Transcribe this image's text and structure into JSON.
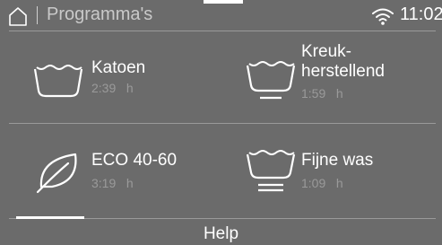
{
  "status_bar": {
    "title": "Programma's",
    "time": "11:02"
  },
  "programs": [
    {
      "name": "Katoen",
      "duration": "2:39",
      "unit": "h",
      "icon": "basin-icon"
    },
    {
      "name": "Kreuk-\nherstellend",
      "duration": "1:59",
      "unit": "h",
      "icon": "basin-one-bar-icon"
    },
    {
      "name": "ECO 40-60",
      "duration": "3:19",
      "unit": "h",
      "icon": "leaf-icon"
    },
    {
      "name": "Fijne was",
      "duration": "1:09",
      "unit": "h",
      "icon": "basin-two-bars-icon"
    }
  ],
  "footer": {
    "help_label": "Help"
  },
  "colors": {
    "background": "#6b6b6b",
    "text": "#ffffff",
    "muted_text": "#9a9a9a",
    "divider": "#9a9a9a"
  }
}
